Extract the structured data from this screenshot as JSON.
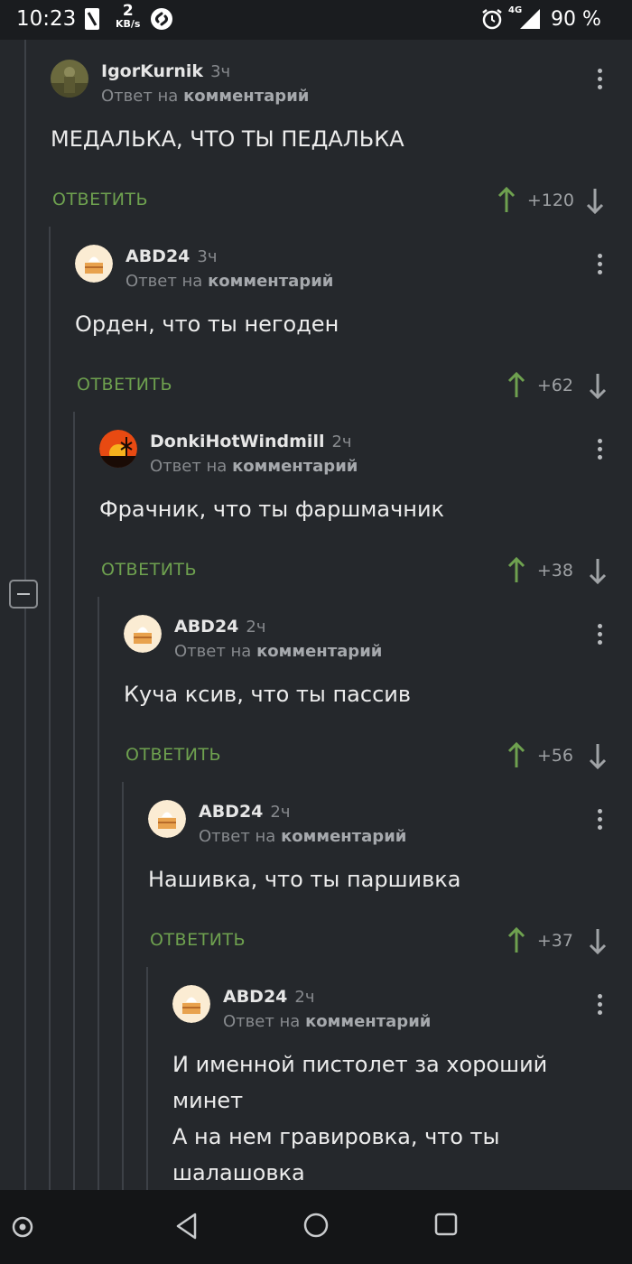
{
  "status_bar": {
    "time": "10:23",
    "net_speed_value": "2",
    "net_speed_unit": "KB/s",
    "network": "4G",
    "battery": "90 %"
  },
  "comments": [
    {
      "user": "IgorKurnik",
      "time": "3ч",
      "reply_prefix": "Ответ на",
      "reply_target": "комментарий",
      "text": "МЕДАЛЬКА, ЧТО ТЫ ПЕДАЛЬКА",
      "reply_label": "ОТВЕТИТЬ",
      "score": "+120",
      "avatar": "soldier-avatar"
    },
    {
      "user": "ABD24",
      "time": "3ч",
      "reply_prefix": "Ответ на",
      "reply_target": "комментарий",
      "text": "Орден, что ты негоден",
      "reply_label": "ОТВЕТИТЬ",
      "score": "+62",
      "avatar": "cake-avatar"
    },
    {
      "user": "DonkiHotWindmill",
      "time": "2ч",
      "reply_prefix": "Ответ на",
      "reply_target": "комментарий",
      "text": "Фрачник, что ты фаршмачник",
      "reply_label": "ОТВЕТИТЬ",
      "score": "+38",
      "avatar": "sunset-windmill-avatar"
    },
    {
      "user": "ABD24",
      "time": "2ч",
      "reply_prefix": "Ответ на",
      "reply_target": "комментарий",
      "text": "Куча ксив, что ты пассив",
      "reply_label": "ОТВЕТИТЬ",
      "score": "+56",
      "avatar": "cake-avatar"
    },
    {
      "user": "ABD24",
      "time": "2ч",
      "reply_prefix": "Ответ на",
      "reply_target": "комментарий",
      "text": "Нашивка, что ты паршивка",
      "reply_label": "ОТВЕТИТЬ",
      "score": "+37",
      "avatar": "cake-avatar"
    },
    {
      "user": "ABD24",
      "time": "2ч",
      "reply_prefix": "Ответ на",
      "reply_target": "комментарий",
      "text_lines": [
        "И именной пистолет за хороший",
        "минет",
        "А на нем гравировка, что ты",
        "шалашовка"
      ],
      "avatar": "cake-avatar"
    }
  ],
  "colors": {
    "background": "#25282c",
    "reply_green": "#6ea14f",
    "upvote_green": "#6ea14f",
    "meta_gray": "#878a8e"
  },
  "nav": [
    "assistant-icon",
    "back-icon",
    "home-icon",
    "recents-icon"
  ]
}
